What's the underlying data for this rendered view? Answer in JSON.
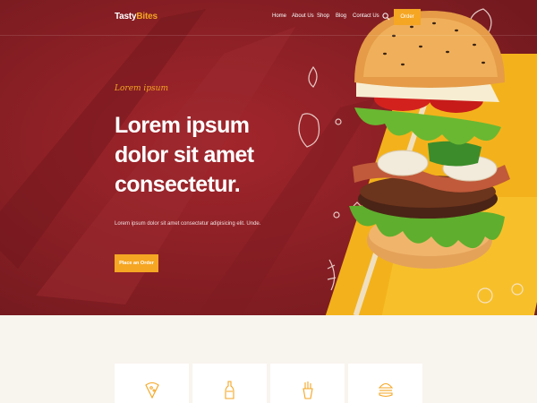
{
  "brand": {
    "name_part1": "Tasty",
    "name_part2": "Bites"
  },
  "nav": {
    "items": [
      {
        "label": "Home"
      },
      {
        "label": "About Us"
      },
      {
        "label": "Shop"
      },
      {
        "label": "Blog"
      },
      {
        "label": "Contact Us"
      }
    ],
    "search_icon": "search-icon",
    "order_label": "Order"
  },
  "hero": {
    "tagline": "Lorem ipsum",
    "headline_lines": [
      "Lorem ipsum",
      "dolor sit amet",
      "consectetur."
    ],
    "description": "Lorem ipsum dolor sit amet consectetur adipisicing elit. Unde.",
    "cta_label": "Place an Order"
  },
  "features": {
    "icons": [
      "pizza-icon",
      "bottle-icon",
      "fries-icon",
      "burger-icon"
    ]
  },
  "colors": {
    "hero_bg": "#8a1f24",
    "accent": "#f5a623",
    "yellow": "#f3b21b",
    "page_bg": "#f8f4ee"
  }
}
